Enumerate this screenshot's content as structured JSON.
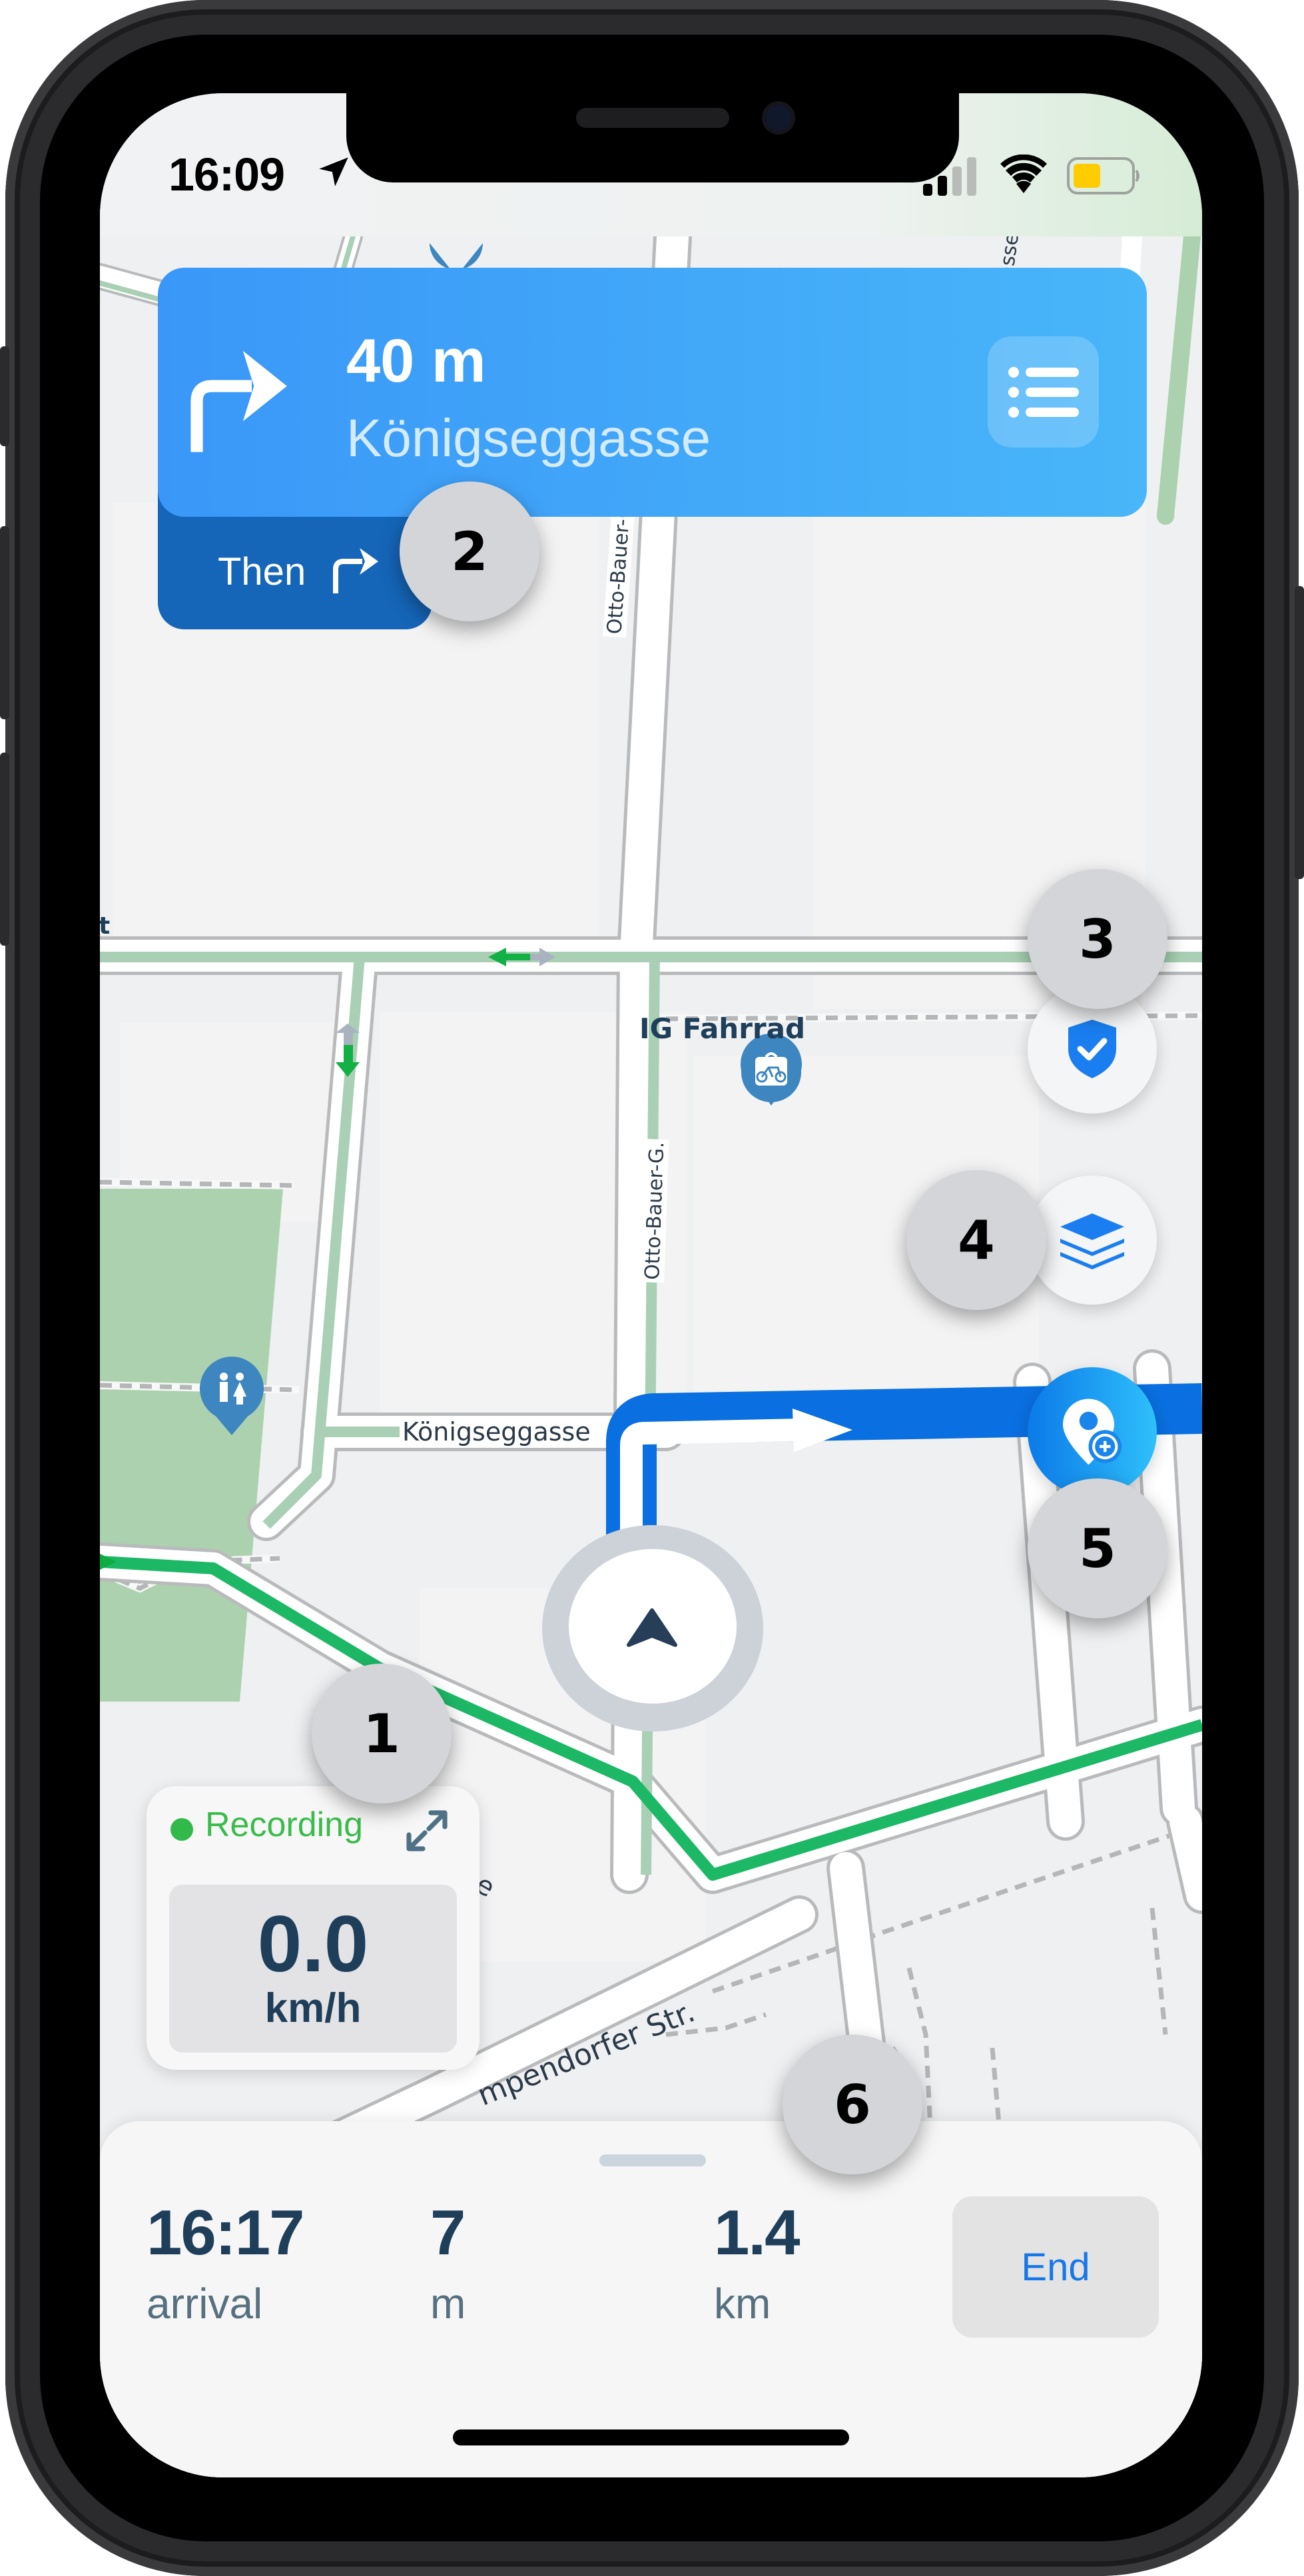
{
  "status_bar": {
    "time": "16:09",
    "location_icon": "location-arrow-icon",
    "signal_icon": "cellular-signal-icon",
    "signal_bars_active": 2,
    "signal_bars_total": 4,
    "wifi_icon": "wifi-icon",
    "battery_icon": "battery-icon",
    "battery_level_fraction": 0.45,
    "battery_color": "#ffcc00"
  },
  "navigation": {
    "turn_icon": "turn-right-arrow-icon",
    "distance": "40 m",
    "street": "Königseggasse",
    "menu_icon": "list-icon",
    "then_label": "Then",
    "then_icon": "turn-right-arrow-icon",
    "banner_color_start": "#3a97f8",
    "banner_color_end": "#48b6f9",
    "then_color": "#1565b8"
  },
  "map": {
    "labels": {
      "otto_bauer_upper": "Otto-Bauer-G.",
      "otto_bauer_lower": "Otto-Bauer-G.",
      "koenigseggasse": "Königseggasse",
      "strasse_partial": "raße",
      "gumpendorfer_partial": "mpendorfer Str.",
      "top_right_partial": "asse",
      "left_edge_partial": "t"
    },
    "pois": [
      {
        "name": "IG Fahrrad",
        "icon": "bike-shop-icon"
      },
      {
        "name": "",
        "icon": "toilets-icon"
      },
      {
        "name": "",
        "icon": "poi-marker-icon"
      }
    ],
    "route_color": "#0a6fe0",
    "bike_lane_color": "#1db866",
    "park_color": "#acd1ae"
  },
  "map_controls": {
    "safety_icon": "shield-check-icon",
    "layers_icon": "layers-icon",
    "add_poi_icon": "add-location-icon"
  },
  "recording": {
    "status": "Recording",
    "status_color": "#3bbb4c",
    "expand_icon": "expand-icon",
    "speed": "0.0",
    "speed_unit": "km/h"
  },
  "trip_summary": {
    "arrival_time": "16:17",
    "arrival_label": "arrival",
    "remaining_distance_m": "7",
    "remaining_distance_m_label": "m",
    "total_distance": "1.4",
    "total_distance_label": "km",
    "end_label": "End"
  },
  "annotations": [
    "1",
    "2",
    "3",
    "4",
    "5",
    "6"
  ]
}
